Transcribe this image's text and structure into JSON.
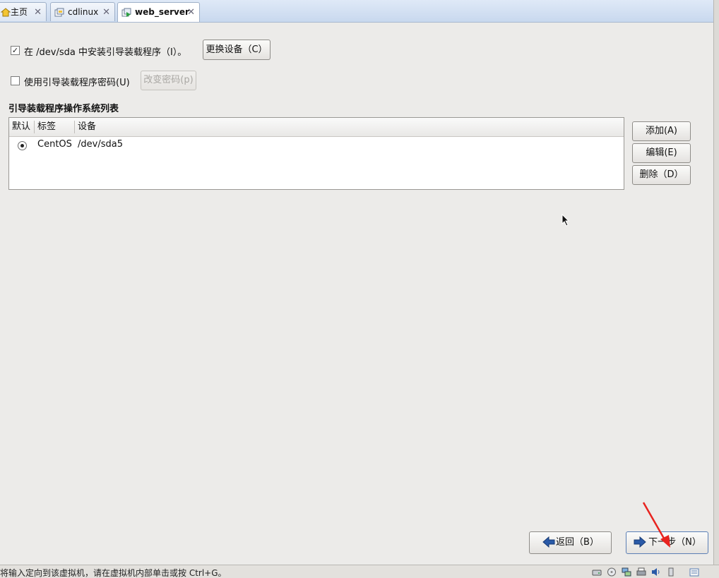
{
  "tabs": [
    {
      "label": "主页",
      "icon": "home-icon",
      "close": "✕"
    },
    {
      "label": "cdlinux",
      "icon": "vm-icon",
      "close": "✕"
    },
    {
      "label": "web_server",
      "icon": "vm-running-icon",
      "close": "✕"
    }
  ],
  "options": {
    "install_checkbox_checked": true,
    "install_label": "在 /dev/sda 中安装引导装载程序（I）。",
    "change_device_label": "更换设备（C）",
    "password_checkbox_checked": false,
    "password_label": "使用引导装载程序密码(U)",
    "change_password_label": "改变密码(p)"
  },
  "os_list": {
    "title": "引导装载程序操作系统列表",
    "columns": [
      "默认",
      "标签",
      "设备"
    ],
    "rows": [
      {
        "default": true,
        "label": "CentOS",
        "device": "/dev/sda5"
      }
    ],
    "add_label": "添加(A)",
    "edit_label": "编辑(E)",
    "delete_label": "删除（D）"
  },
  "nav": {
    "back_label": "返回（B）",
    "next_label": "下一步（N）"
  },
  "status": {
    "text": "将输入定向到该虚拟机，请在虚拟机内部单击或按 Ctrl+G。"
  },
  "colors": {
    "accent_blue": "#2a5aa8",
    "annotation_red": "#e8231f"
  }
}
